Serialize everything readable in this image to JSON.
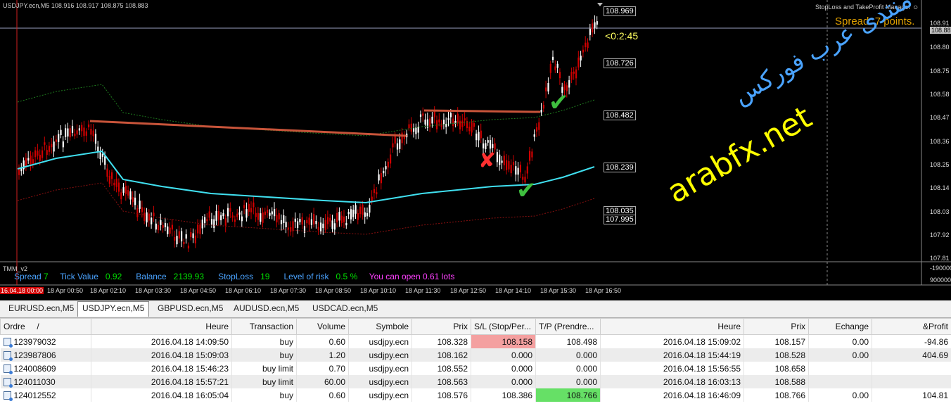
{
  "chart": {
    "header": "USDJPY.ecn,M5  108.916 108.917 108.875 108.883",
    "expert": "StopLoss and TakeProfit Manager",
    "expert_icon": "smiley-icon",
    "spread_label": "Spread: 7 points.",
    "countdown": "<0:2:45",
    "price_levels": [
      "108.969",
      "108.726",
      "108.482",
      "108.239",
      "108.035",
      "107.995"
    ],
    "axis_prices": [
      "108.91",
      "108.883",
      "108.80",
      "108.75",
      "108.58",
      "108.47",
      "108.36",
      "108.25",
      "108.14",
      "108.03",
      "107.92",
      "107.81"
    ],
    "watermark_arabic": "منتدى عرب فوركس",
    "watermark_domain": "arabfx.net"
  },
  "indicator": {
    "name": "TMM_v2",
    "spread_label": "Spread",
    "spread_value": "7",
    "tick_label": "Tick Value",
    "tick_value": "0.92",
    "balance_label": "Balance",
    "balance_value": "2139.93",
    "sl_label": "StopLoss",
    "sl_value": "19",
    "risk_label": "Level of risk",
    "risk_value": "0.5 %",
    "lots_text": "You can open 0.61 lots",
    "axis_top": "-1900000",
    "axis_bottom": "9000000"
  },
  "time_axis": {
    "first": "16.04.18 00:00",
    "labels": [
      "18 Apr 00:50",
      "18 Apr 02:10",
      "18 Apr 03:30",
      "18 Apr 04:50",
      "18 Apr 06:10",
      "18 Apr 07:30",
      "18 Apr 08:50",
      "18 Apr 10:10",
      "18 Apr 11:30",
      "18 Apr 12:50",
      "18 Apr 14:10",
      "18 Apr 15:30",
      "18 Apr 16:50"
    ]
  },
  "tabs": [
    "EURUSD.ecn,M5",
    "USDJPY.ecn,M5",
    "GBPUSD.ecn,M5",
    "AUDUSD.ecn,M5",
    "USDCAD.ecn,M5"
  ],
  "active_tab": "USDJPY.ecn,M5",
  "table": {
    "headers": [
      "Ordre",
      "Heure",
      "Transaction",
      "Volume",
      "Symbole",
      "Prix",
      "S/L (Stop/Per...",
      "T/P (Prendre...",
      "Heure",
      "Prix",
      "Echange",
      "&Profit"
    ],
    "sort_marker": "/",
    "rows": [
      [
        "123979032",
        "2016.04.18 14:09:50",
        "buy",
        "0.60",
        "usdjpy.ecn",
        "108.328",
        "108.158",
        "108.498",
        "2016.04.18 15:09:02",
        "108.157",
        "0.00",
        "-94.86"
      ],
      [
        "123987806",
        "2016.04.18 15:09:03",
        "buy",
        "1.20",
        "usdjpy.ecn",
        "108.162",
        "0.000",
        "0.000",
        "2016.04.18 15:44:19",
        "108.528",
        "0.00",
        "404.69"
      ],
      [
        "124008609",
        "2016.04.18 15:46:23",
        "buy limit",
        "0.70",
        "usdjpy.ecn",
        "108.552",
        "0.000",
        "0.000",
        "2016.04.18 15:56:55",
        "108.658",
        "",
        ""
      ],
      [
        "124011030",
        "2016.04.18 15:57:21",
        "buy limit",
        "60.00",
        "usdjpy.ecn",
        "108.563",
        "0.000",
        "0.000",
        "2016.04.18 16:03:13",
        "108.588",
        "",
        ""
      ],
      [
        "124012552",
        "2016.04.18 16:05:04",
        "buy",
        "0.60",
        "usdjpy.ecn",
        "108.576",
        "108.386",
        "108.766",
        "2016.04.18 16:46:09",
        "108.766",
        "0.00",
        "104.81"
      ]
    ]
  },
  "colors": {
    "spread_label": "#e0a000",
    "countdown": "#ffff60",
    "watermark_arabic": "#4aa3ff",
    "watermark_domain": "#ffff00",
    "trendline": "#c8543a",
    "ma_line": "#40e0f0",
    "sl_highlight": "#f4a0a0",
    "tp_highlight": "#66e066"
  }
}
